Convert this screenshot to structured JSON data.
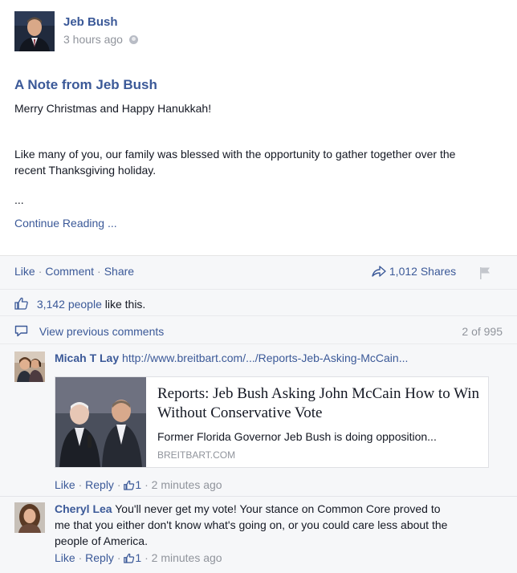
{
  "post": {
    "author": "Jeb Bush",
    "time": "3 hours ago",
    "title": "A Note from Jeb Bush",
    "greeting": "Merry Christmas and Happy Hanukkah!",
    "paragraph_line1": "Like many of you, our family was blessed with the opportunity to gather together over the",
    "paragraph_line2": "recent Thanksgiving holiday.",
    "ellipsis": "...",
    "continue": "Continue Reading ..."
  },
  "ufi": {
    "like": "Like",
    "comment": "Comment",
    "share": "Share",
    "shares": "1,012 Shares",
    "likes_count": "3,142 people",
    "likes_suffix": "like this.",
    "view_previous": "View previous comments",
    "pager": "2 of 995"
  },
  "comments": [
    {
      "name": "Micah T Lay",
      "text": "http://www.breitbart.com/.../Reports-Jeb-Asking-McCain...",
      "card": {
        "title": "Reports: Jeb Bush Asking John McCain How to Win Without Conservative Vote",
        "description": "Former Florida Governor Jeb Bush is doing opposition...",
        "domain": "BREITBART.COM"
      },
      "like": "Like",
      "reply": "Reply",
      "likes": "1",
      "time": "2 minutes ago"
    },
    {
      "name": "Cheryl Lea",
      "text_line1": "You'll never get my vote! Your stance on Common Core proved to",
      "text_line2": "me that you either don't know what's going on, or you could care less about the",
      "text_line3": "people of America.",
      "like": "Like",
      "reply": "Reply",
      "likes": "1",
      "time": "2 minutes ago"
    }
  ],
  "colors": {
    "link": "#3b5998",
    "muted": "#90949c",
    "ufi_background": "#f6f7f9"
  }
}
